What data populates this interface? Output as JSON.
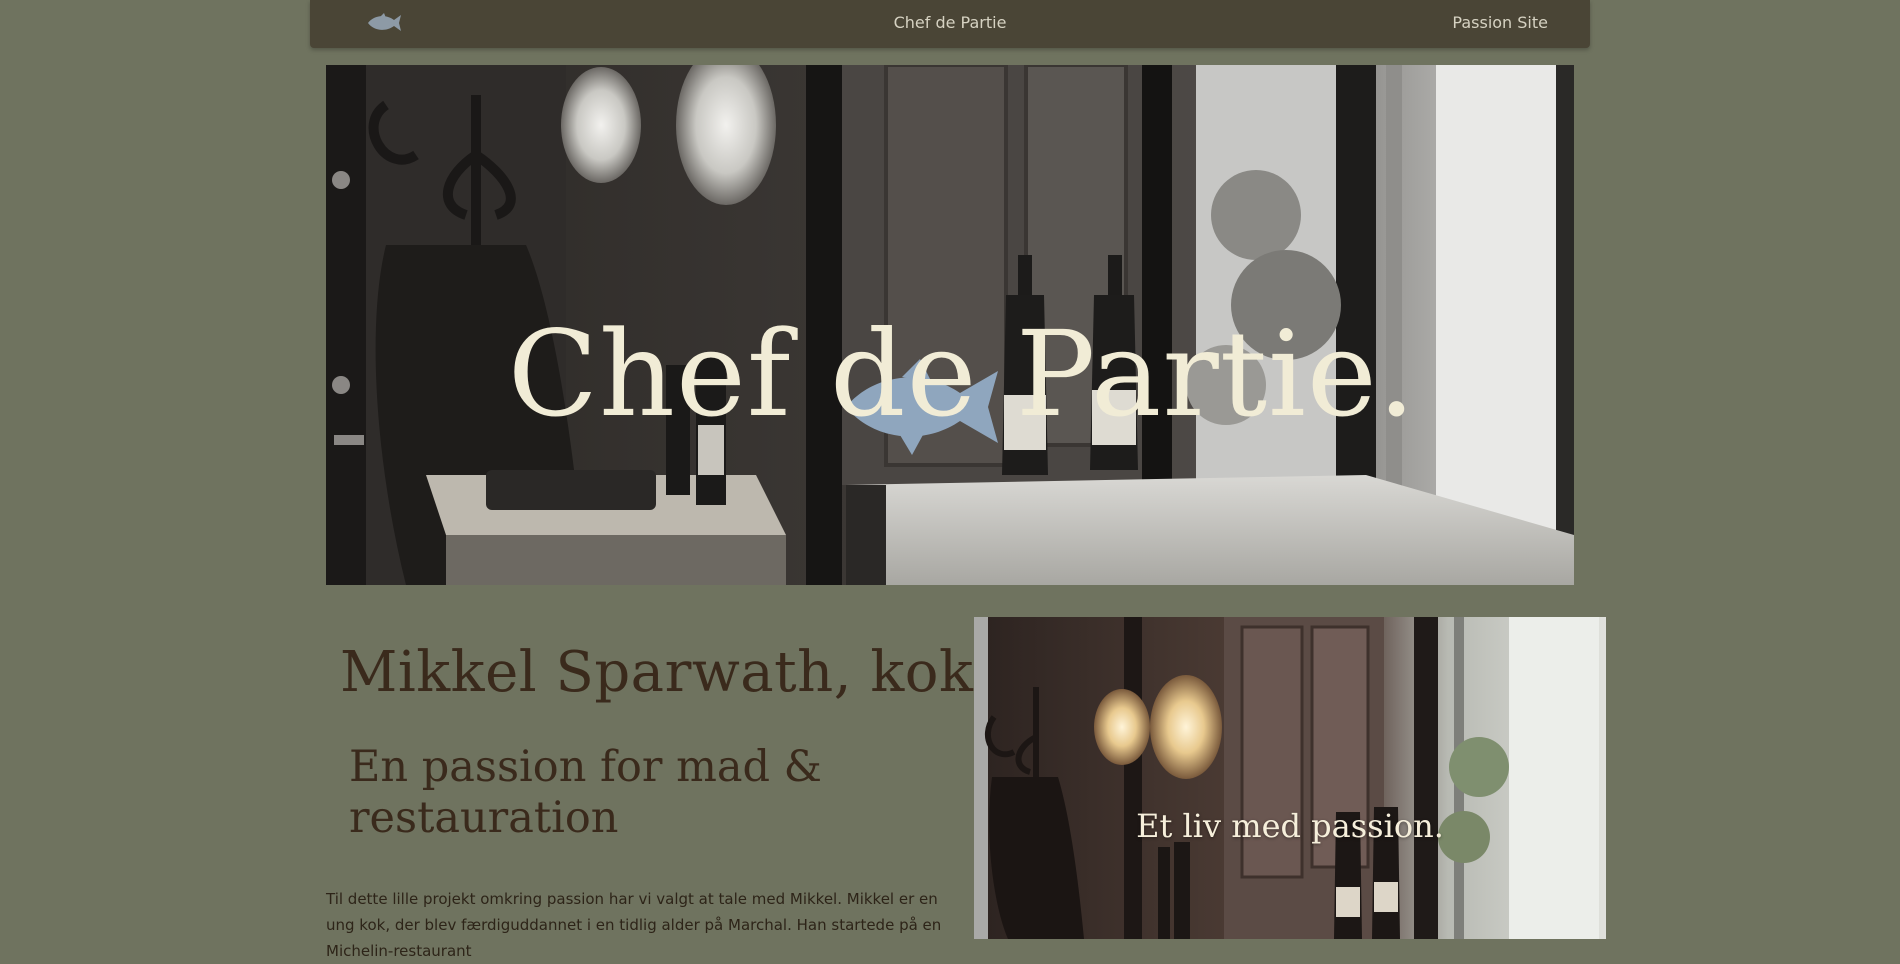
{
  "nav": {
    "logo_icon": "fish-icon",
    "title": "Chef de Partie",
    "link": "Passion Site"
  },
  "hero": {
    "title": "Chef de Partie.",
    "fish_icon": "fish-icon",
    "fish_color": "#8fa6be"
  },
  "main": {
    "heading": "Mikkel Sparwath, kok",
    "subheading": "En passion for mad & restauration",
    "intro": "Til dette lille projekt omkring passion har vi valgt at tale med Mikkel. Mikkel er en ung kok, der blev færdiguddannet i en tidlig alder på Marchal. Han startede på en Michelin-restaurant"
  },
  "side": {
    "caption": "Et liv med passion."
  },
  "colors": {
    "background": "#6f735f",
    "navbar": "#4a4536",
    "heading": "#3a2a1c",
    "hero_text": "#f1ecd6"
  }
}
